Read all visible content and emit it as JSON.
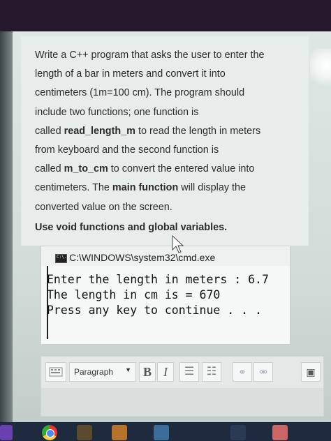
{
  "question": {
    "line1": "Write a C++ program that asks the user to enter the",
    "line2": "length of a bar in meters and convert it into",
    "line3": "centimeters (1m=100 cm). The program should",
    "line4": "include two functions; one function is",
    "line5_pre": "called ",
    "line5_bold": "read_length_m",
    "line5_post": " to read the length in meters",
    "line6": "from keyboard and the second function is",
    "line7_pre": "called ",
    "line7_bold": "m_to_cm",
    "line7_post": " to convert the entered value into",
    "line8_pre": "centimeters. The ",
    "line8_bold": "main function",
    "line8_post": " will display the",
    "line9": "converted value on the screen.",
    "void_note": "Use void functions and global variables."
  },
  "console": {
    "title": "C:\\WINDOWS\\system32\\cmd.exe",
    "icon_text": "C:\\.",
    "lines": [
      "Enter the length in meters : 6.7",
      "The length in cm is = 670",
      "Press any key to continue . . ."
    ]
  },
  "editor_toolbar": {
    "paragraph_label": "Paragraph",
    "bold_label": "B",
    "italic_label": "I",
    "icons": [
      "keyboard-icon",
      "bullet-list-icon",
      "numbered-list-icon",
      "link-icon",
      "unlink-icon",
      "image-icon"
    ]
  }
}
